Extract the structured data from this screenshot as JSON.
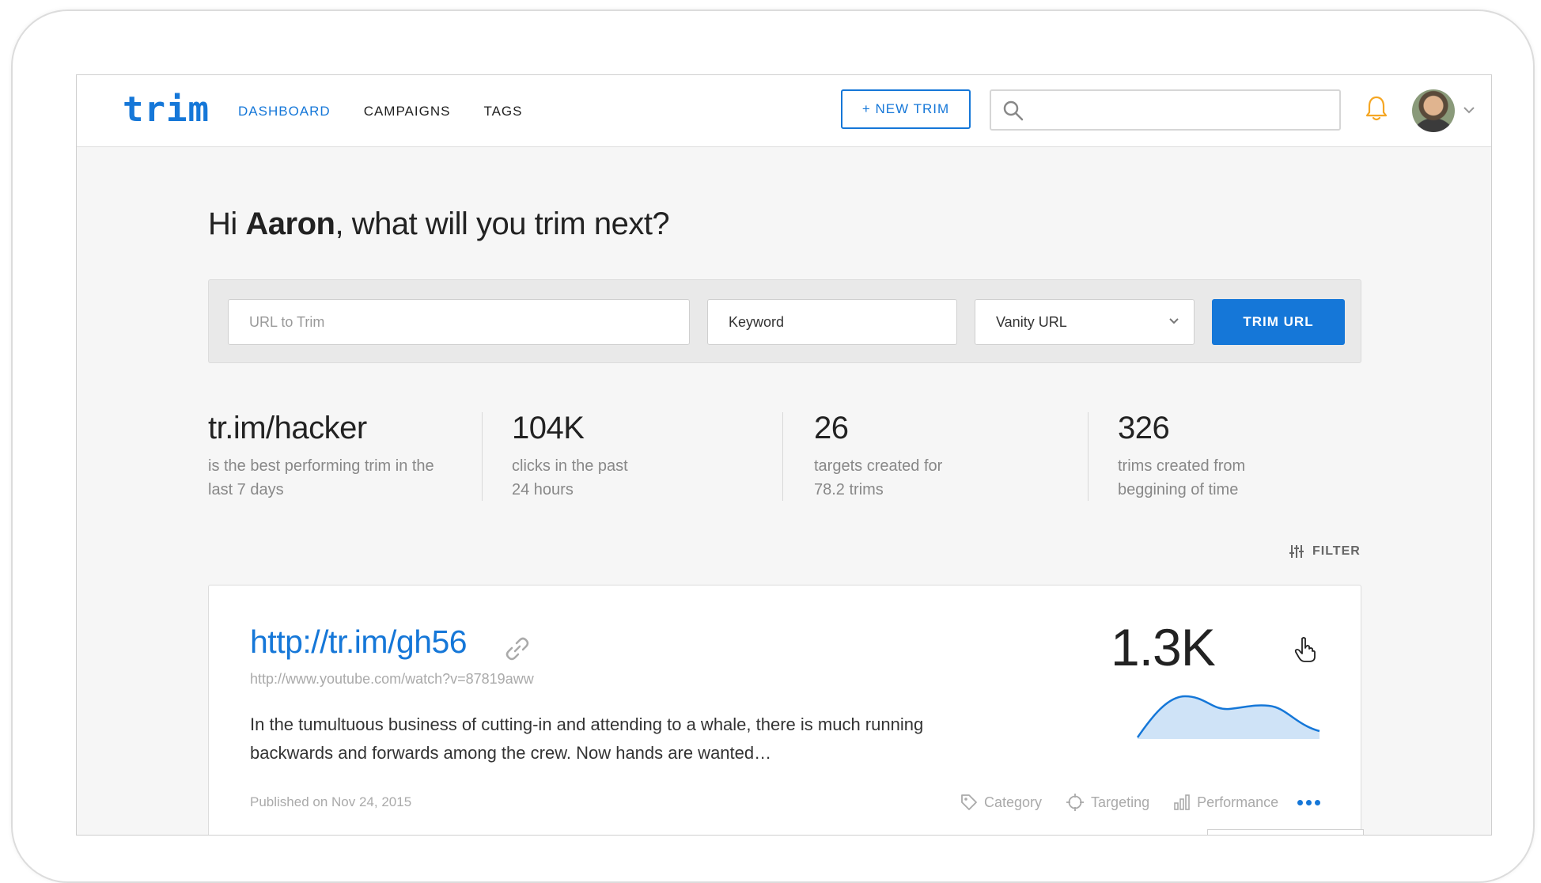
{
  "header": {
    "logo": "trim",
    "nav": [
      {
        "label": "DASHBOARD",
        "active": true
      },
      {
        "label": "CAMPAIGNS",
        "active": false
      },
      {
        "label": "TAGS",
        "active": false
      }
    ],
    "new_trim_label": "+ NEW TRIM",
    "search_placeholder": "",
    "icons": {
      "search": "search-icon",
      "notifications": "bell-icon",
      "menu": "chevron-down-icon"
    }
  },
  "greeting": {
    "prefix": "Hi ",
    "name": "Aaron",
    "suffix": ", what will you trim next?"
  },
  "trim_form": {
    "url_placeholder": "URL to Trim",
    "keyword_value": "Keyword",
    "vanity_selected": "Vanity URL",
    "submit_label": "TRIM URL"
  },
  "stats": [
    {
      "value": "tr.im/hacker",
      "description": "is the best performing trim in the last 7 days"
    },
    {
      "value": "104K",
      "description": "clicks in the past 24 hours"
    },
    {
      "value": "26",
      "description": "targets created for 78.2 trims"
    },
    {
      "value": "326",
      "description": "trims created from beggining of time"
    }
  ],
  "filter_label": "FILTER",
  "trim_card": {
    "short_url": "http://tr.im/gh56",
    "source_url": "http://www.youtube.com/watch?v=87819aww",
    "excerpt": "In the tumultuous business of cutting-in and attending to a whale, there is much running backwards and forwards among the crew. Now hands are wanted…",
    "published": "Published on Nov 24, 2015",
    "clicks": "1.3K",
    "actions": [
      "Category",
      "Targeting",
      "Performance"
    ]
  },
  "colors": {
    "accent": "#1577d8",
    "notification": "#f5a623",
    "sparkline_fill": "#cfe3f7"
  }
}
